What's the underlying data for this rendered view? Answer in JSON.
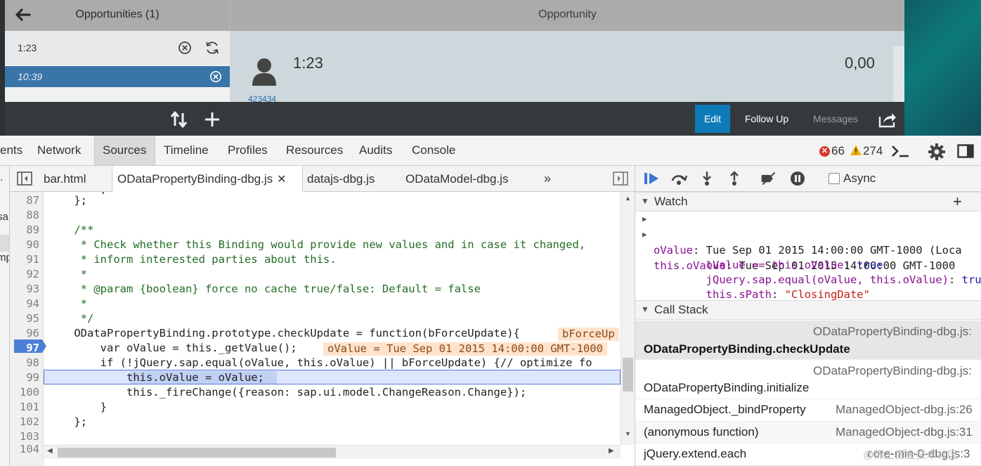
{
  "app": {
    "master_title": "Opportunities (1)",
    "search_value": "1:23",
    "selected_item": "10:39",
    "detail_title": "Opportunity",
    "object_title": "1:23",
    "object_number": "0,00",
    "object_link": "423434",
    "footer_buttons": {
      "edit": "Edit",
      "follow_up": "Follow Up",
      "messages": "Messages"
    },
    "colors": {
      "header": "#ababab",
      "selected_item": "#3a75a8",
      "footer": "#35393c",
      "edit_button": "#0f7ab8"
    }
  },
  "devtools": {
    "main_tabs": [
      "ents",
      "Network",
      "Sources",
      "Timeline",
      "Profiles",
      "Resources",
      "Audits",
      "Console"
    ],
    "active_main_tab": "Sources",
    "error_count": "66",
    "warning_count": "274",
    "left_fragments": [
      ".",
      "sa",
      "mp"
    ],
    "editor_tabs": [
      "bar.html",
      "ODataPropertyBinding-dbg.js",
      "datajs-dbg.js",
      "ODataModel-dbg.js"
    ],
    "active_editor_tab": "ODataPropertyBinding-dbg.js",
    "more_tabs": "»",
    "code": {
      "top_fragment": "        ;",
      "lines": [
        {
          "n": "87",
          "text": "    };"
        },
        {
          "n": "88",
          "text": ""
        },
        {
          "n": "89",
          "text": "    /**"
        },
        {
          "n": "90",
          "text": "     * Check whether this Binding would provide new values and in case it changed,"
        },
        {
          "n": "91",
          "text": "     * inform interested parties about this."
        },
        {
          "n": "92",
          "text": "     *"
        },
        {
          "n": "93",
          "text": "     * @param {boolean} force no cache true/false: Default = false"
        },
        {
          "n": "94",
          "text": "     *"
        },
        {
          "n": "95",
          "text": "     */"
        },
        {
          "n": "96",
          "text": "    ODataPropertyBinding.prototype.checkUpdate = function(bForceUpdate){"
        },
        {
          "n": "97",
          "text": "        var oValue = this._getValue();"
        },
        {
          "n": "98",
          "text": "        if (!jQuery.sap.equal(oValue, this.oValue) || bForceUpdate) {// optimize fo"
        },
        {
          "n": "99",
          "text": "            this.oValue = oValue;"
        },
        {
          "n": "100",
          "text": "            this._fireChange({reason: sap.ui.model.ChangeReason.Change});"
        },
        {
          "n": "101",
          "text": "        }"
        },
        {
          "n": "102",
          "text": "    };"
        },
        {
          "n": "103",
          "text": ""
        },
        {
          "n": "104",
          "text": ""
        }
      ],
      "inline_values": {
        "line96": "bForceUp",
        "line97": "oValue = Tue Sep 01 2015 14:00:00 GMT-1000"
      },
      "breakpoint_line": "97",
      "paused_line": "99"
    },
    "debugger": {
      "async_label": "Async",
      "watch_title": "Watch",
      "watch_add": "+",
      "watch": [
        {
          "expr": "oValue",
          "value": "Tue Sep 01 2015 14:00:00 GMT-1000 (Loca",
          "kind": "object",
          "expandable": true
        },
        {
          "expr": "this.oValue",
          "value": "Tue Sep 01 2015 14:00:00 GMT-1000",
          "kind": "object",
          "expandable": true
        },
        {
          "expr": "oValue == this.oValue",
          "value": "true",
          "kind": "bool",
          "expandable": false
        },
        {
          "expr": "jQuery.sap.equal(oValue, this.oValue)",
          "value": "true",
          "kind": "bool",
          "expandable": false
        },
        {
          "expr": "this.sPath",
          "value": "\"ClosingDate\"",
          "kind": "string",
          "expandable": false
        }
      ],
      "callstack_title": "Call Stack",
      "callstack": [
        {
          "fn": "ODataPropertyBinding.checkUpdate",
          "loc": "ODataPropertyBinding-dbg.js:"
        },
        {
          "fn": "ODataPropertyBinding.initialize",
          "loc": "ODataPropertyBinding-dbg.js:"
        },
        {
          "fn": "ManagedObject._bindProperty",
          "loc": "ManagedObject-dbg.js:26"
        },
        {
          "fn": "(anonymous function)",
          "loc": "ManagedObject-dbg.js:31"
        },
        {
          "fn": "jQuery.extend.each",
          "loc": "core-min-0-dbg.js:3"
        }
      ]
    },
    "watermark": "@稀土掘金技术社区"
  }
}
